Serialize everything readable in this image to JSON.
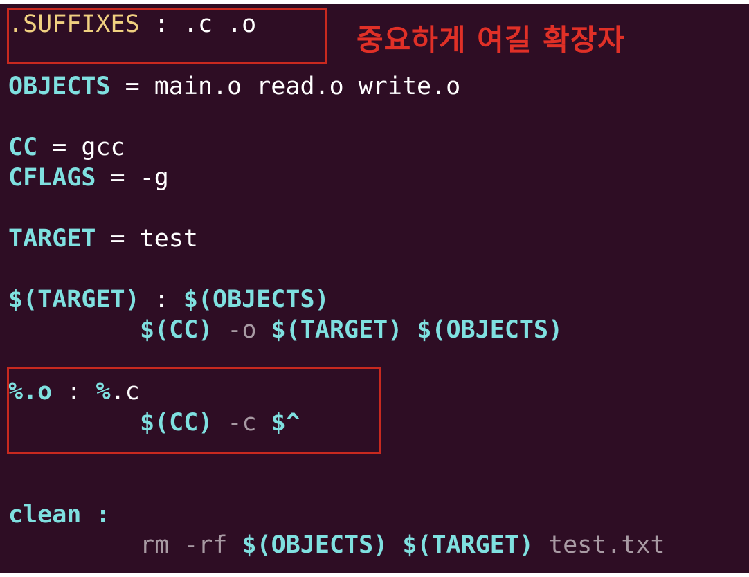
{
  "makefile": {
    "suffixes": {
      "name": ".SUFFIXES",
      "sep": " : ",
      "value": ".c .o"
    },
    "objects": {
      "name": "OBJECTS",
      "op": " = ",
      "value": "main.o read.o write.o"
    },
    "cc": {
      "name": "CC",
      "op": " = ",
      "value": "gcc"
    },
    "cflags": {
      "name": "CFLAGS",
      "op": " = ",
      "value": "-g"
    },
    "target_var": {
      "name": "TARGET",
      "op": " = ",
      "value": "test"
    },
    "target_rule": {
      "target": "$(TARGET)",
      "sep": " : ",
      "deps": "$(OBJECTS)"
    },
    "target_cmd": {
      "cc": "$(CC)",
      "flag": " -o ",
      "target": "$(TARGET)",
      "objs": " $(OBJECTS)"
    },
    "pattern_rule": {
      "target": "%.o",
      "sep": " : ",
      "dep_pct": "%",
      "dep_ext": ".c"
    },
    "pattern_cmd": {
      "cc": "$(CC)",
      "flag": " -c ",
      "auto": "$^"
    },
    "clean_rule": {
      "target": "clean",
      "sep": " :"
    },
    "clean_cmd": {
      "rm": "rm -rf ",
      "objs": "$(OBJECTS)",
      "sp": " ",
      "target": "$(TARGET)",
      "file": " test.txt"
    }
  },
  "annotation": {
    "text": "중요하게 여길 확장자",
    "color": "#e03027"
  },
  "colors": {
    "background": "#2e0d24",
    "keyword": "#7fe0e0",
    "dim": "#a89aa3",
    "suffix": "#f0d080",
    "highlight": "#c8291f"
  }
}
